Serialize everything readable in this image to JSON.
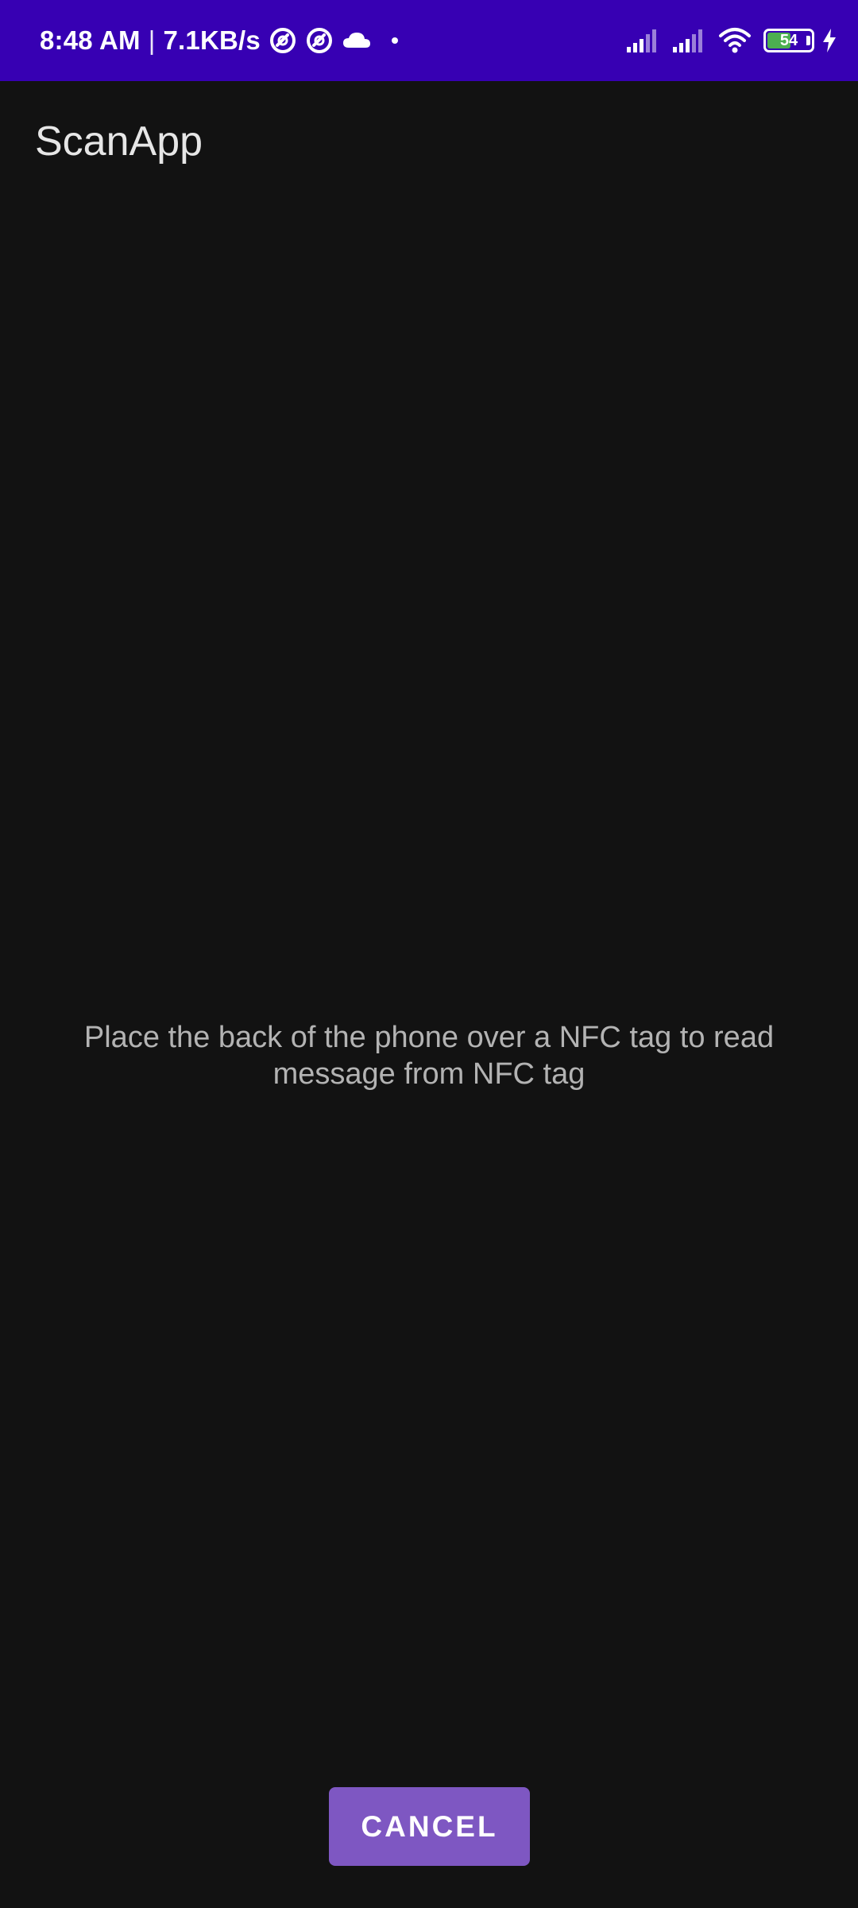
{
  "status_bar": {
    "time": "8:48 AM",
    "separator": "|",
    "network_speed": "7.1KB/s",
    "battery_level": "54",
    "battery_fraction": 0.54,
    "background_color": "#3700b3",
    "left_icons": [
      "at-sign-icon",
      "at-sign-icon",
      "cloud-icon",
      "dot-icon"
    ],
    "right_icons": [
      "cell-signal-icon",
      "cell-signal-icon",
      "wifi-icon",
      "battery-icon",
      "charging-bolt-icon"
    ]
  },
  "app_bar": {
    "title": "ScanApp"
  },
  "main": {
    "message": "Place the back of the phone over a NFC tag to read message from NFC tag"
  },
  "actions": {
    "cancel_label": "CANCEL",
    "cancel_color": "#7e57c2"
  },
  "theme": {
    "background": "#121212",
    "title_color": "#e6e6e6",
    "text_color": "#b3b3b3"
  }
}
